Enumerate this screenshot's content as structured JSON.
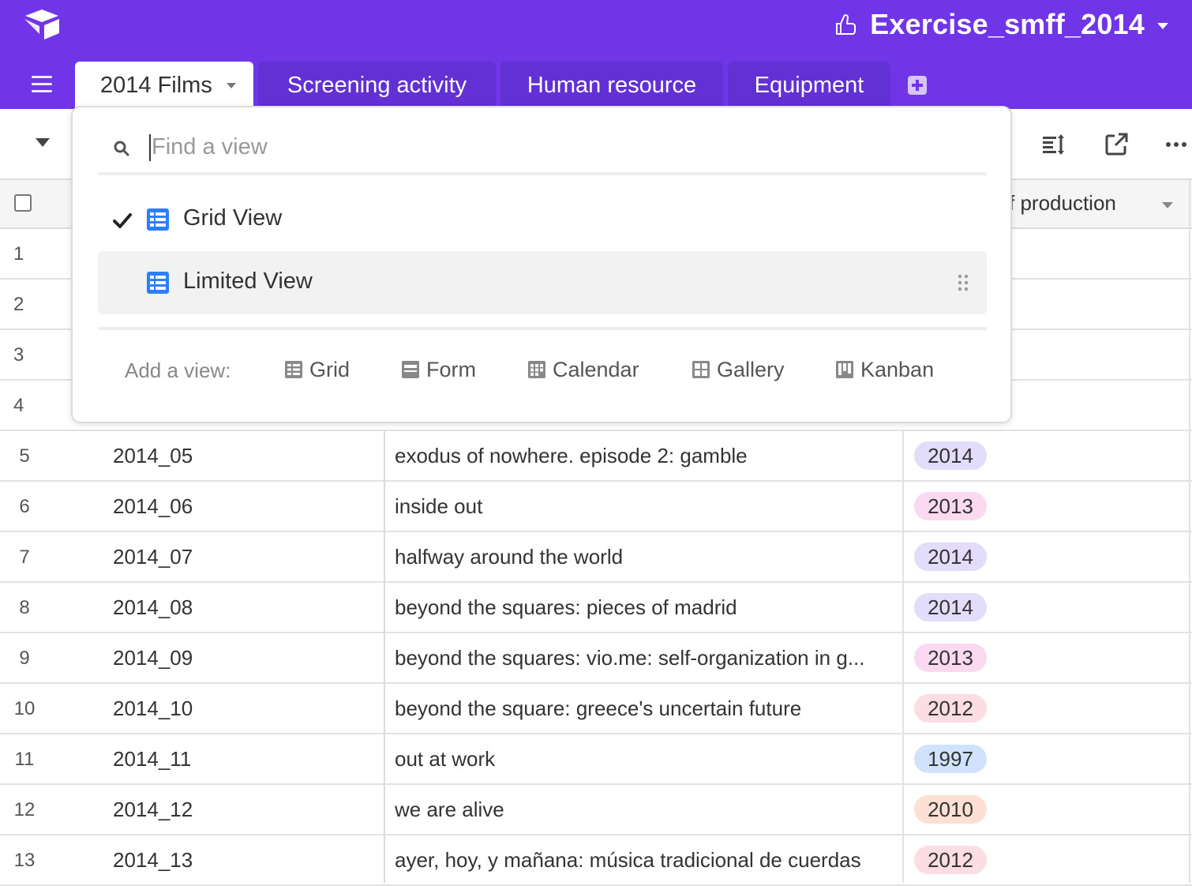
{
  "header": {
    "base_title": "Exercise_smff_2014"
  },
  "tabs": [
    {
      "label": "2014 Films"
    },
    {
      "label": "Screening activity"
    },
    {
      "label": "Human resource"
    },
    {
      "label": "Equipment"
    }
  ],
  "column_header": {
    "partial_label": "f production"
  },
  "view_menu": {
    "search_placeholder": "Find a view",
    "views": [
      {
        "label": "Grid View",
        "selected": true
      },
      {
        "label": "Limited View",
        "selected": false
      }
    ],
    "add_view_label": "Add a view:",
    "add_options": [
      {
        "label": "Grid",
        "icon": "grid-icon"
      },
      {
        "label": "Form",
        "icon": "form-icon"
      },
      {
        "label": "Calendar",
        "icon": "calendar-icon"
      },
      {
        "label": "Gallery",
        "icon": "gallery-icon"
      },
      {
        "label": "Kanban",
        "icon": "kanban-icon"
      }
    ]
  },
  "hidden_rows": [
    "1",
    "2",
    "3",
    "4"
  ],
  "rows": [
    {
      "num": "5",
      "film_id": "2014_05",
      "title": "exodus of nowhere. episode 2: gamble",
      "year": "2014",
      "year_color": "#e4dcfb"
    },
    {
      "num": "6",
      "film_id": "2014_06",
      "title": "inside out",
      "year": "2013",
      "year_color": "#fbd9f1"
    },
    {
      "num": "7",
      "film_id": "2014_07",
      "title": "halfway around the world",
      "year": "2014",
      "year_color": "#e4dcfb"
    },
    {
      "num": "8",
      "film_id": "2014_08",
      "title": "beyond the squares: pieces of madrid",
      "year": "2014",
      "year_color": "#e4dcfb"
    },
    {
      "num": "9",
      "film_id": "2014_09",
      "title": "beyond the squares: vio.me: self-organization in g...",
      "year": "2013",
      "year_color": "#fbd9f1"
    },
    {
      "num": "10",
      "film_id": "2014_10",
      "title": "beyond the square: greece's uncertain future",
      "year": "2012",
      "year_color": "#fddde4"
    },
    {
      "num": "11",
      "film_id": "2014_11",
      "title": "out at work",
      "year": "1997",
      "year_color": "#d1e2fd"
    },
    {
      "num": "12",
      "film_id": "2014_12",
      "title": "we are alive",
      "year": "2010",
      "year_color": "#fde0d3"
    },
    {
      "num": "13",
      "film_id": "2014_13",
      "title": "ayer, hoy, y mañana: música tradicional de cuerdas",
      "year": "2012",
      "year_color": "#fddde4"
    }
  ],
  "colors": {
    "topbar": "#7135e8",
    "inactive_tab": "#6330d4",
    "view_icon": "#2d7ff9"
  }
}
